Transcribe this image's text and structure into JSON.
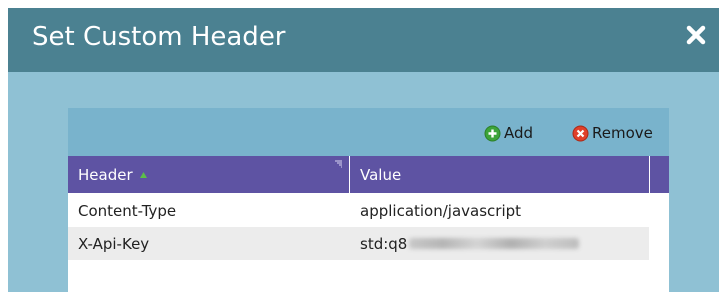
{
  "dialog": {
    "title": "Set Custom Header"
  },
  "toolbar": {
    "add_label": "Add",
    "remove_label": "Remove"
  },
  "table": {
    "columns": [
      "Header",
      "Value"
    ],
    "rows": [
      {
        "header": "Content-Type",
        "value": "application/javascript"
      },
      {
        "header": "X-Api-Key",
        "value": "std:q8"
      }
    ]
  },
  "colors": {
    "titlebar": "#4b8191",
    "backdrop": "#8fc1d4",
    "toolbar": "#79b3cc",
    "table_header": "#5e53a3"
  }
}
